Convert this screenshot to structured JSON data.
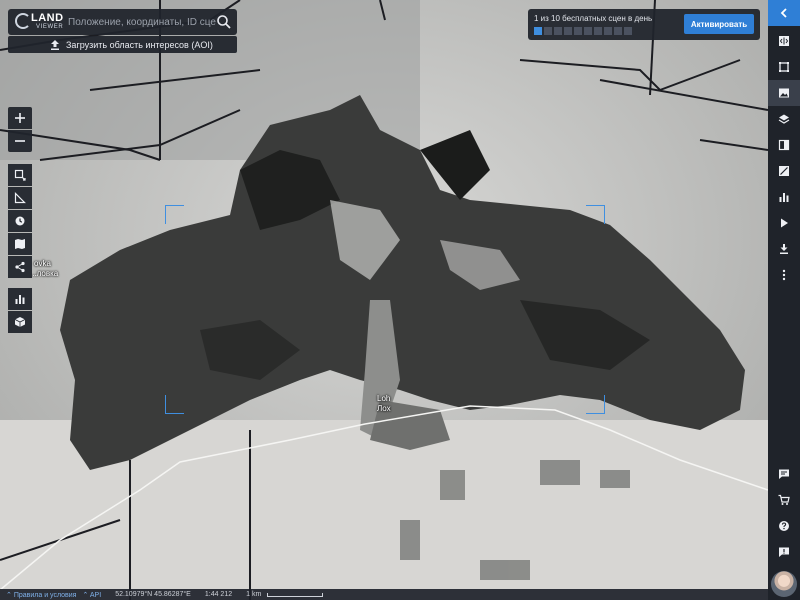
{
  "app": {
    "logo_line1": "LAND",
    "logo_line2": "VIEWER"
  },
  "search": {
    "placeholder": "Положение, координаты, ID сцен...",
    "aoi_label": "Загрузить область интересов (AOI)"
  },
  "quota": {
    "text": "1 из 10 бесплатных сцен в день",
    "used": 1,
    "total": 10,
    "activate_label": "Активировать"
  },
  "map": {
    "labels": {
      "town_latin": "Loh",
      "town_cyrillic": "Лох",
      "village_latin": "ovka",
      "village_cyrillic": "...ловка"
    }
  },
  "statusbar": {
    "terms": "Правила и условия",
    "api": "API",
    "coordinates": "52.10979°N 45.86287°E",
    "scale_ratio": "1:44 212",
    "scale_label": "1 km"
  },
  "colors": {
    "panel": "#20242c",
    "accent": "#2f7fd6",
    "sidebar": "#1f232a"
  },
  "icons": {
    "left_tools": [
      "zoom-in-icon",
      "zoom-out-icon",
      "select-area-icon",
      "ruler-icon",
      "time-icon",
      "map-book-icon",
      "share-icon",
      "chart-icon",
      "cube-icon"
    ],
    "right_tools": [
      "collapse-icon",
      "compare-icon",
      "crop-icon",
      "image-icon",
      "layers-icon",
      "split-view-icon",
      "index-icon",
      "analytics-icon",
      "play-icon",
      "download-icon",
      "more-icon",
      "feedback-icon",
      "cart-icon",
      "help-icon",
      "chat-icon"
    ]
  }
}
